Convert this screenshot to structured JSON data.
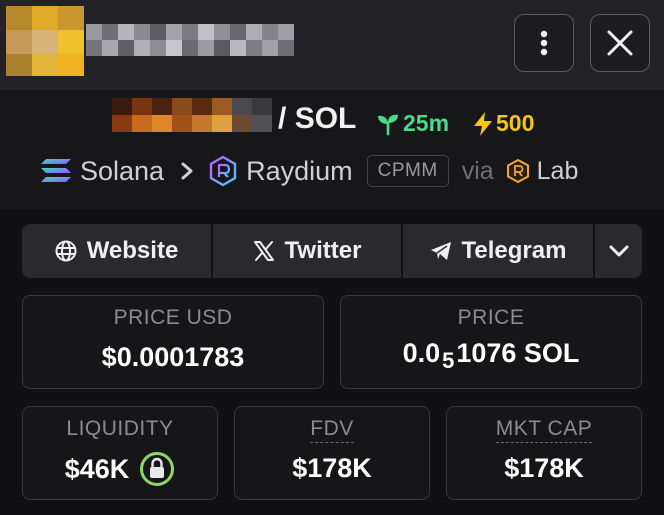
{
  "header": {
    "more_icon": "vertical-dots-icon",
    "close_icon": "close-icon"
  },
  "pair": {
    "quote": "SOL",
    "separator": "/",
    "age": "25m",
    "age_icon": "sprout-icon",
    "boosts": "500",
    "boost_icon": "lightning-icon",
    "chain": "Solana",
    "dex": "Raydium",
    "pool_type": "CPMM",
    "via": "via",
    "launchpad": "Lab"
  },
  "links": {
    "website": "Website",
    "twitter": "Twitter",
    "telegram": "Telegram"
  },
  "stats": {
    "price_usd_label": "PRICE USD",
    "price_usd_value": "$0.0001783",
    "price_label": "PRICE",
    "price_value_prefix": "0.0",
    "price_value_zeros": "5",
    "price_value_suffix": "1076 SOL",
    "liquidity_label": "LIQUIDITY",
    "liquidity_value": "$46K",
    "fdv_label": "FDV",
    "fdv_value": "$178K",
    "mkt_cap_label": "MKT CAP",
    "mkt_cap_value": "$178K"
  },
  "colors": {
    "age_green": "#4cd98a",
    "boost_yellow": "#f5c518",
    "lock_ring": "#8ed66a"
  }
}
